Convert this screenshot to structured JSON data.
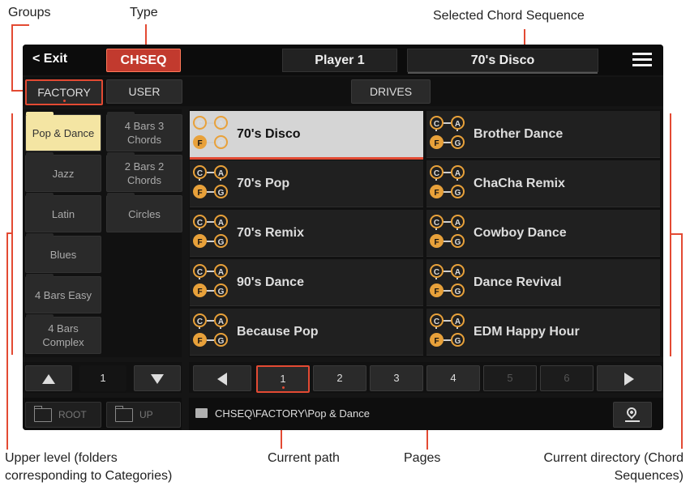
{
  "annotations": {
    "groups": "Groups",
    "type": "Type",
    "selected_chord_sequence": "Selected Chord Sequence",
    "upper_level_line1": "Upper level (folders",
    "upper_level_line2": "corresponding to Categories)",
    "current_path": "Current path",
    "pages": "Pages",
    "current_dir_line1": "Current directory (Chord",
    "current_dir_line2": "Sequences)"
  },
  "topbar": {
    "exit_label": "< Exit",
    "type_label": "CHSEQ",
    "player_label": "Player 1",
    "selected_sequence": "70's Disco"
  },
  "source_tabs": {
    "factory": "FACTORY",
    "user": "USER",
    "drives": "DRIVES"
  },
  "categories": {
    "col1": [
      "Pop & Dance",
      "Jazz",
      "Latin",
      "Blues",
      "4 Bars Easy",
      "4 Bars Complex"
    ],
    "col2": [
      "4 Bars 3 Chords",
      "2 Bars 2 Chords",
      "Circles"
    ]
  },
  "icon_letters": {
    "tl": "C",
    "tr": "A",
    "bl": "F",
    "br": "G"
  },
  "sequences": {
    "left": [
      "70's Disco",
      "70's Pop",
      "70's Remix",
      "90's Dance",
      "Because Pop"
    ],
    "right": [
      "Brother Dance",
      "ChaCha Remix",
      "Cowboy Dance",
      "Dance Revival",
      "EDM Happy Hour"
    ]
  },
  "category_page": {
    "current": "1"
  },
  "pages": [
    "1",
    "2",
    "3",
    "4",
    "5",
    "6"
  ],
  "bottom": {
    "root_label": "ROOT",
    "up_label": "UP",
    "path": "CHSEQ\\FACTORY\\Pop & Dance"
  },
  "colors": {
    "accent": "#e34a33",
    "selected_category": "#f4e5a3",
    "icon_orange": "#e8a13a"
  }
}
